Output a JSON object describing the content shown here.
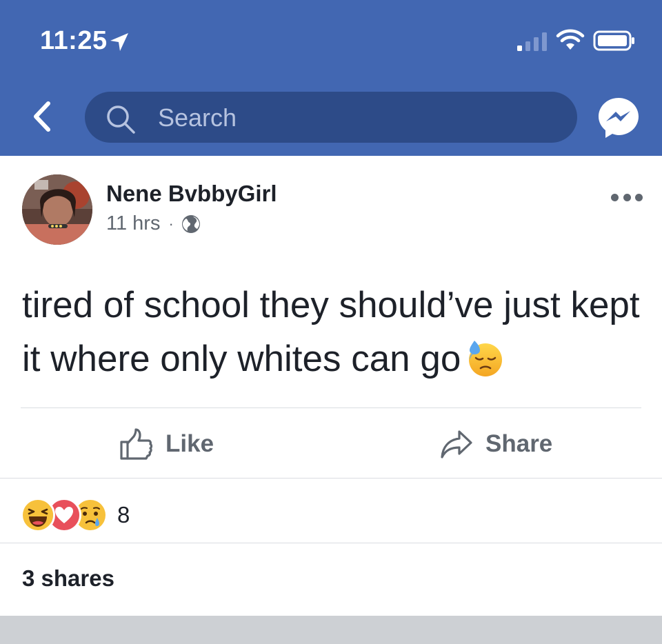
{
  "status_bar": {
    "time": "11:25",
    "location_icon": "location-arrow-icon",
    "signal_icon": "cell-signal-icon",
    "wifi_icon": "wifi-icon",
    "battery_icon": "battery-icon"
  },
  "nav": {
    "back_icon": "chevron-left-icon",
    "search_placeholder": "Search",
    "messenger_icon": "messenger-icon",
    "bar_color": "#4267b2"
  },
  "post": {
    "author": "Nene BvbbyGirl",
    "time": "11 hrs",
    "separator": "·",
    "privacy_icon": "globe-icon",
    "text": "tired of school they should’ve just kept it where only whites can go",
    "inline_emoji": "sweat-face-emoji",
    "actions": {
      "like_label": "Like",
      "share_label": "Share"
    },
    "reactions": {
      "types": [
        "haha",
        "love",
        "sad"
      ],
      "count": "8"
    },
    "shares": "3 shares"
  }
}
